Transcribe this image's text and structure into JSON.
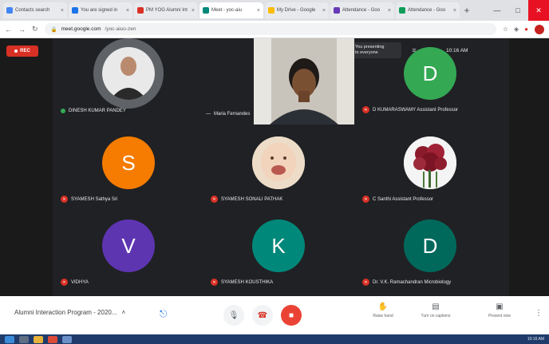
{
  "browser": {
    "tabs": [
      {
        "label": "Contacts search",
        "color": "#4285f4",
        "active": false
      },
      {
        "label": "You are signed in",
        "color": "#1a73e8",
        "active": false
      },
      {
        "label": "PM YOG Alumni Int",
        "color": "#d93025",
        "active": false
      },
      {
        "label": "Meet - yoc-aiu",
        "color": "#00897b",
        "active": true
      },
      {
        "label": "My Drive - Google",
        "color": "#fbbc04",
        "active": false
      },
      {
        "label": "Attendance - Goo",
        "color": "#673ab7",
        "active": false
      },
      {
        "label": "Attendance - Goo",
        "color": "#0f9d58",
        "active": false
      }
    ],
    "url": "meet.google.com",
    "url_path": "/yoc-aiuo-zen"
  },
  "meet": {
    "rec_label": "REC",
    "presenter": {
      "line1": "You presenting",
      "line2": "to everyone"
    },
    "clock": "10:16 AM",
    "video_label": "Maria Fernandes",
    "tiles": [
      {
        "name": "DINESH KUMAR PANDEY",
        "initial": "",
        "color": "#3c4043",
        "muted": false,
        "kind": "photo-man"
      },
      {
        "name": "D KUMARASWAMY Assistant Professor",
        "initial": "D",
        "color": "#34a853",
        "muted": true,
        "kind": "letter"
      },
      {
        "name": "SYAMESH Sathya Sri",
        "initial": "S",
        "color": "#f57c00",
        "muted": true,
        "kind": "letter"
      },
      {
        "name": "SYAMESH SONALI PATHAK",
        "initial": "",
        "color": "#efe6dc",
        "muted": true,
        "kind": "photo-baby"
      },
      {
        "name": "C Santhi Assistant Professor",
        "initial": "",
        "color": "#f0f0f0",
        "muted": true,
        "kind": "photo-flowers"
      },
      {
        "name": "VIDHYA",
        "initial": "V",
        "color": "#5e35b1",
        "muted": true,
        "kind": "letter"
      },
      {
        "name": "SYAMESH KOUSTHIKA",
        "initial": "K",
        "color": "#00897b",
        "muted": true,
        "kind": "letter"
      },
      {
        "name": "Dr. V.K. Ramachandran Microbiology",
        "initial": "D",
        "color": "#00695c",
        "muted": true,
        "kind": "letter"
      }
    ]
  },
  "bottombar": {
    "meeting_name": "Alumni Interaction Program - 2020...",
    "tools": [
      {
        "label": "Raise hand"
      },
      {
        "label": "Turn on captions"
      },
      {
        "label": "Present now"
      }
    ]
  },
  "taskbar": {
    "tray": "10:16 AM"
  }
}
